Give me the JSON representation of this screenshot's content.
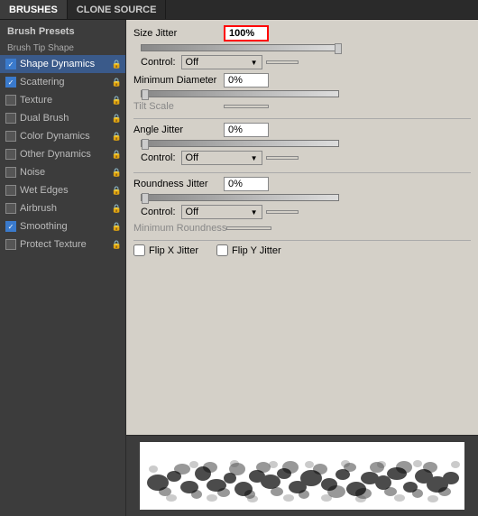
{
  "tabs": [
    {
      "id": "brushes",
      "label": "BRUSHES",
      "active": true
    },
    {
      "id": "clone-source",
      "label": "CLONE SOURCE",
      "active": false
    }
  ],
  "sidebar": {
    "header": "Brush Presets",
    "section_label": "Brush Tip Shape",
    "items": [
      {
        "id": "shape-dynamics",
        "label": "Shape Dynamics",
        "checked": true,
        "active": true,
        "has_lock": true
      },
      {
        "id": "scattering",
        "label": "Scattering",
        "checked": true,
        "active": false,
        "has_lock": true
      },
      {
        "id": "texture",
        "label": "Texture",
        "checked": false,
        "active": false,
        "has_lock": true
      },
      {
        "id": "dual-brush",
        "label": "Dual Brush",
        "checked": false,
        "active": false,
        "has_lock": true
      },
      {
        "id": "color-dynamics",
        "label": "Color Dynamics",
        "checked": false,
        "active": false,
        "has_lock": true
      },
      {
        "id": "other-dynamics",
        "label": "Other Dynamics",
        "checked": false,
        "active": false,
        "has_lock": true
      },
      {
        "id": "noise",
        "label": "Noise",
        "checked": false,
        "active": false,
        "has_lock": true
      },
      {
        "id": "wet-edges",
        "label": "Wet Edges",
        "checked": false,
        "active": false,
        "has_lock": true
      },
      {
        "id": "airbrush",
        "label": "Airbrush",
        "checked": false,
        "active": false,
        "has_lock": true
      },
      {
        "id": "smoothing",
        "label": "Smoothing",
        "checked": true,
        "active": false,
        "has_lock": true
      },
      {
        "id": "protect-texture",
        "label": "Protect Texture",
        "checked": false,
        "active": false,
        "has_lock": true
      }
    ]
  },
  "main": {
    "size_jitter": {
      "label": "Size Jitter",
      "value": "100%",
      "highlighted": true
    },
    "control1": {
      "label": "Control:",
      "value": "Off"
    },
    "minimum_diameter": {
      "label": "Minimum Diameter",
      "value": "0%"
    },
    "tilt_scale": {
      "label": "Tilt Scale",
      "value": ""
    },
    "angle_jitter": {
      "label": "Angle Jitter",
      "value": "0%"
    },
    "control2": {
      "label": "Control:",
      "value": "Off"
    },
    "roundness_jitter": {
      "label": "Roundness Jitter",
      "value": "0%"
    },
    "control3": {
      "label": "Control:",
      "value": "Off"
    },
    "minimum_roundness": {
      "label": "Minimum Roundness",
      "value": ""
    },
    "flip_x": {
      "label": "Flip X Jitter",
      "checked": false
    },
    "flip_y": {
      "label": "Flip Y Jitter",
      "checked": false
    }
  }
}
